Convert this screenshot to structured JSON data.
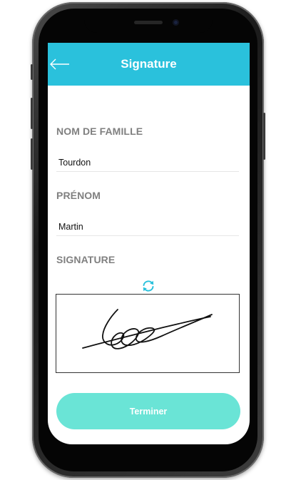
{
  "header": {
    "title": "Signature",
    "back_icon": "arrow-left-icon"
  },
  "form": {
    "lastname_label": "NOM DE FAMILLE",
    "lastname_value": "Tourdon",
    "firstname_label": "PRÉNOM",
    "firstname_value": "Martin",
    "signature_label": "SIGNATURE",
    "refresh_icon": "refresh-icon"
  },
  "actions": {
    "finish_label": "Terminer"
  },
  "colors": {
    "header": "#2ac1dc",
    "button": "#6ae4d6",
    "label": "#808080"
  }
}
